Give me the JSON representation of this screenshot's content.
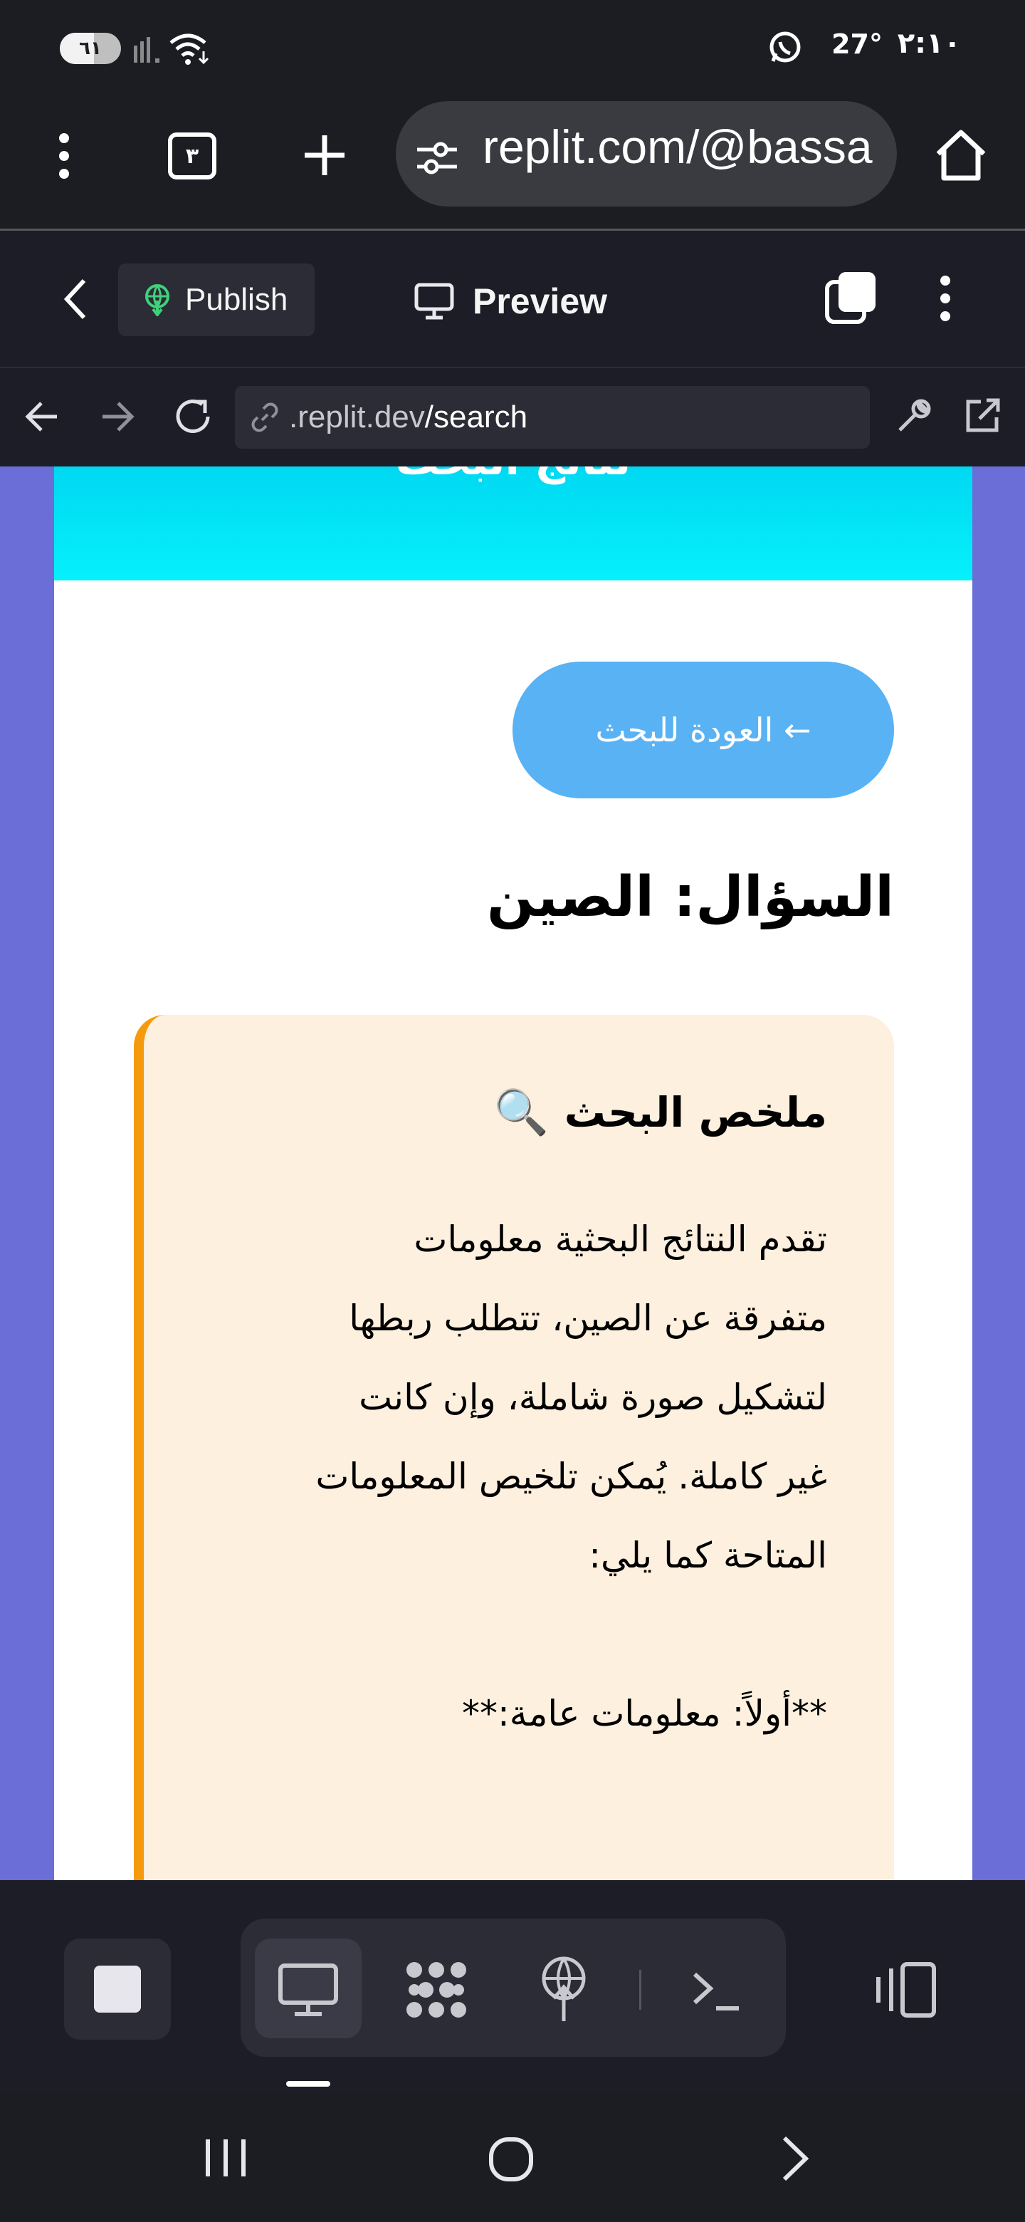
{
  "status_bar": {
    "battery": "٦١",
    "weather_temp": "27°",
    "time": "٢:١٠",
    "icons": [
      "signal-icon",
      "wifi-icon",
      "whatsapp-icon"
    ]
  },
  "browser": {
    "url": "replit.com/@bassa",
    "tab_count": "٣",
    "icons": [
      "menu-dots-icon",
      "tabs-icon",
      "new-tab-icon",
      "site-settings-icon",
      "home-icon"
    ]
  },
  "replit_header": {
    "publish_label": "Publish",
    "preview_label": "Preview"
  },
  "webview_nav": {
    "address_prefix": ".replit.dev",
    "address_path": "/search"
  },
  "page": {
    "banner_title": "نتائج البحث",
    "back_button": "← العودة للبحث",
    "question": "السؤال: الصين",
    "summary_title": "ملخص البحث",
    "summary_icon": "🔍",
    "summary_body": "تقدم النتائج البحثية معلومات\nمتفرقة عن الصين، تتطلب ربطها\nلتشكيل صورة شاملة، وإن كانت\nغير كاملة. يُمكن تلخيص المعلومات\nالمتاحة كما يلي:\n\n**أولاً: معلومات عامة:**\n\n\nتُشير النتائج إلى وجود عملية",
    "colors": {
      "page_bg": "#6a6ed6",
      "banner": "#00e5f7",
      "back_button": "#58b2f4",
      "summary_bg": "#fdf0df",
      "summary_accent": "#f59a0c"
    }
  },
  "bottom_bar": {
    "icons": [
      "stop-icon",
      "desktop-icon",
      "extensions-icon",
      "deploy-icon",
      "shell-icon",
      "layout-toggle-icon"
    ]
  },
  "system_nav": {
    "icons": [
      "recents-icon",
      "home-circle-icon",
      "back-chevron-icon"
    ]
  }
}
